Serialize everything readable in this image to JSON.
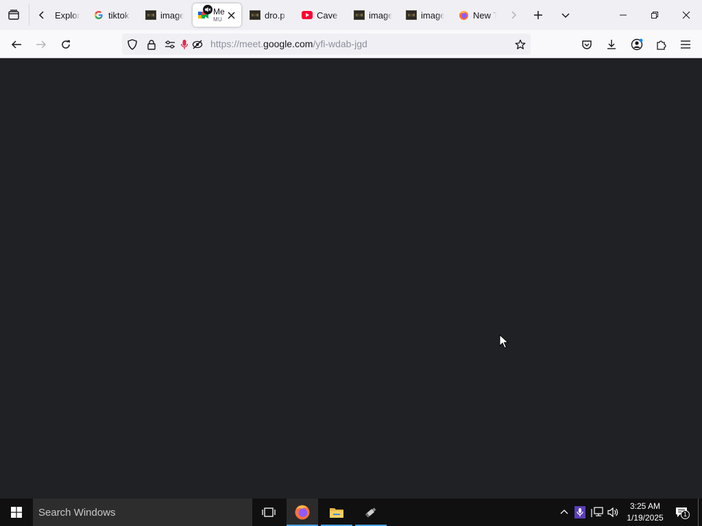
{
  "window": {
    "minimize_label": "Minimize",
    "restore_label": "Restore",
    "close_label": "Close"
  },
  "tabstrip": {
    "tabs": [
      {
        "title": "Explor",
        "favicon": "none"
      },
      {
        "title": "tiktok",
        "favicon": "google-g-icon"
      },
      {
        "title": "image",
        "favicon": "image-thumbnail-icon"
      },
      {
        "title": "Me",
        "subtitle": "MU",
        "favicon": "google-meet-icon",
        "active": true,
        "muted": true
      },
      {
        "title": "dro.p",
        "favicon": "image-thumbnail-icon"
      },
      {
        "title": "Cave S",
        "favicon": "youtube-icon"
      },
      {
        "title": "image",
        "favicon": "image-thumbnail-icon"
      },
      {
        "title": "image",
        "favicon": "image-thumbnail-icon"
      },
      {
        "title": "New T",
        "favicon": "firefox-icon"
      }
    ]
  },
  "navbar": {
    "url_prefix": "https://meet.",
    "url_domain": "google.com",
    "url_path": "/yfi-wdab-jgd"
  },
  "taskbar": {
    "search_placeholder": "Search Windows",
    "time": "3:25 AM",
    "date": "1/19/2025",
    "notification_count": "1"
  },
  "colors": {
    "content_bg": "#202124",
    "tabstrip_bg": "#f0f0f4",
    "taskbar_bg": "#101010",
    "taskbar_accent": "#4aa6e8",
    "mic_active": "#e22850"
  }
}
